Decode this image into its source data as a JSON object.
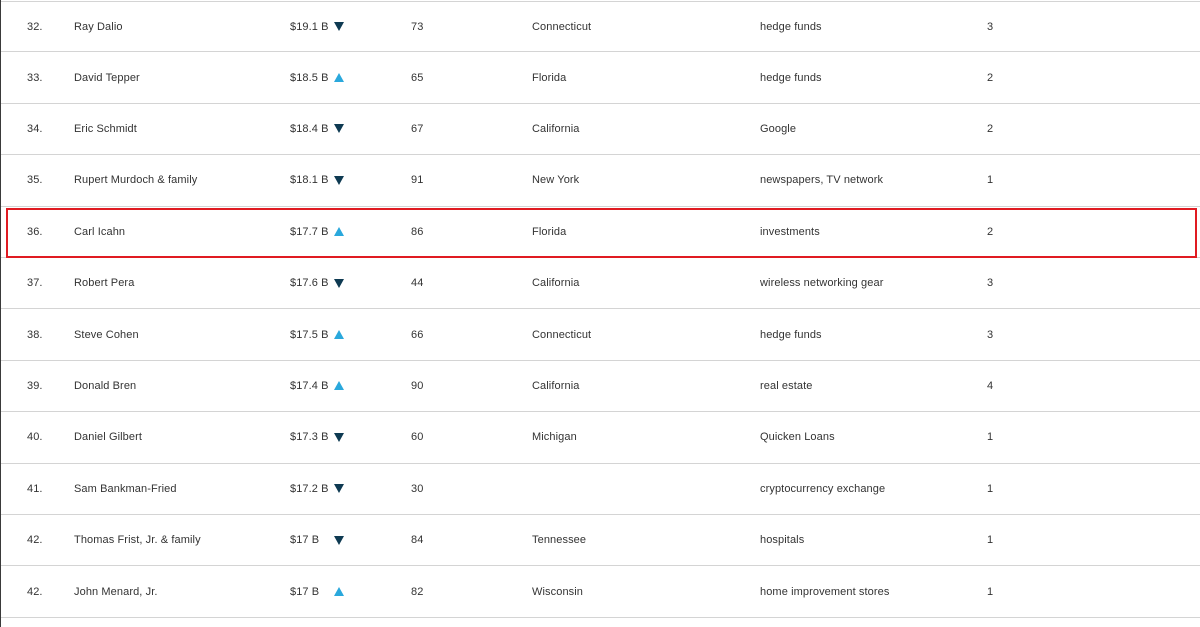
{
  "colors": {
    "arrow_up": "#2aa8dc",
    "arrow_down": "#0e3a52",
    "highlight": "#e01b22",
    "divider": "#d4d4d4"
  },
  "rows": [
    {
      "rank": "32.",
      "name": "Ray Dalio",
      "worth": "$19.1 B",
      "trend": "down",
      "trend_icon": "arrow-down-icon",
      "age": "73",
      "state": "Connecticut",
      "source": "hedge funds",
      "generation": "3"
    },
    {
      "rank": "33.",
      "name": "David Tepper",
      "worth": "$18.5 B",
      "trend": "up",
      "trend_icon": "arrow-up-icon",
      "age": "65",
      "state": "Florida",
      "source": "hedge funds",
      "generation": "2"
    },
    {
      "rank": "34.",
      "name": "Eric Schmidt",
      "worth": "$18.4 B",
      "trend": "down",
      "trend_icon": "arrow-down-icon",
      "age": "67",
      "state": "California",
      "source": "Google",
      "generation": "2"
    },
    {
      "rank": "35.",
      "name": "Rupert Murdoch & family",
      "worth": "$18.1 B",
      "trend": "down",
      "trend_icon": "arrow-down-icon",
      "age": "91",
      "state": "New York",
      "source": "newspapers, TV network",
      "generation": "1"
    },
    {
      "rank": "36.",
      "name": "Carl Icahn",
      "worth": "$17.7 B",
      "trend": "up",
      "trend_icon": "arrow-up-icon",
      "age": "86",
      "state": "Florida",
      "source": "investments",
      "generation": "2",
      "highlighted": true
    },
    {
      "rank": "37.",
      "name": "Robert Pera",
      "worth": "$17.6 B",
      "trend": "down",
      "trend_icon": "arrow-down-icon",
      "age": "44",
      "state": "California",
      "source": "wireless networking gear",
      "generation": "3"
    },
    {
      "rank": "38.",
      "name": "Steve Cohen",
      "worth": "$17.5 B",
      "trend": "up",
      "trend_icon": "arrow-up-icon",
      "age": "66",
      "state": "Connecticut",
      "source": "hedge funds",
      "generation": "3"
    },
    {
      "rank": "39.",
      "name": "Donald Bren",
      "worth": "$17.4 B",
      "trend": "up",
      "trend_icon": "arrow-up-icon",
      "age": "90",
      "state": "California",
      "source": "real estate",
      "generation": "4"
    },
    {
      "rank": "40.",
      "name": "Daniel Gilbert",
      "worth": "$17.3 B",
      "trend": "down",
      "trend_icon": "arrow-down-icon",
      "age": "60",
      "state": "Michigan",
      "source": "Quicken Loans",
      "generation": "1"
    },
    {
      "rank": "41.",
      "name": "Sam Bankman-Fried",
      "worth": "$17.2 B",
      "trend": "down",
      "trend_icon": "arrow-down-icon",
      "age": "30",
      "state": "",
      "source": "cryptocurrency exchange",
      "generation": "1"
    },
    {
      "rank": "42.",
      "name": "Thomas Frist, Jr. & family",
      "worth": "$17 B",
      "trend": "down",
      "trend_icon": "arrow-down-icon",
      "age": "84",
      "state": "Tennessee",
      "source": "hospitals",
      "generation": "1"
    },
    {
      "rank": "42.",
      "name": "John Menard, Jr.",
      "worth": "$17 B",
      "trend": "up",
      "trend_icon": "arrow-up-icon",
      "age": "82",
      "state": "Wisconsin",
      "source": "home improvement stores",
      "generation": "1"
    }
  ]
}
